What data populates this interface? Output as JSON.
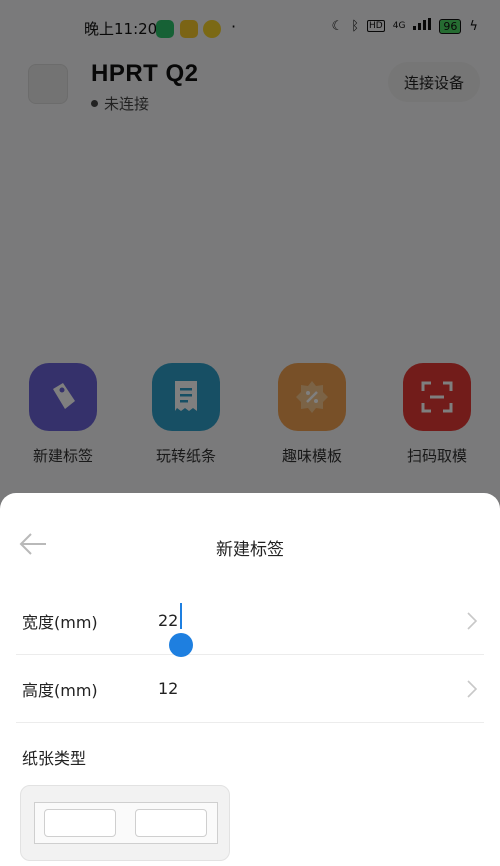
{
  "status_bar": {
    "time": "晚上11:20",
    "dot": "·",
    "network": "4G",
    "hd": "HD",
    "battery": "96"
  },
  "header": {
    "device_name": "HPRT Q2",
    "connection_status": "未连接",
    "connect_button": "连接设备"
  },
  "features": [
    {
      "label": "新建标签",
      "icon": "tag-icon",
      "color": "#6a63d6"
    },
    {
      "label": "玩转纸条",
      "icon": "receipt-icon",
      "color": "#2e9fc9"
    },
    {
      "label": "趣味模板",
      "icon": "template-icon",
      "color": "#f0a050"
    },
    {
      "label": "扫码取模",
      "icon": "scan-icon",
      "color": "#e53935"
    }
  ],
  "sheet": {
    "title": "新建标签",
    "width_label": "宽度(mm)",
    "width_value": "22",
    "height_label": "高度(mm)",
    "height_value": "12",
    "paper_type_label": "纸张类型"
  },
  "colors": {
    "accent": "#1e7fe0",
    "overlay": "rgba(0,0,0,0.5)"
  }
}
